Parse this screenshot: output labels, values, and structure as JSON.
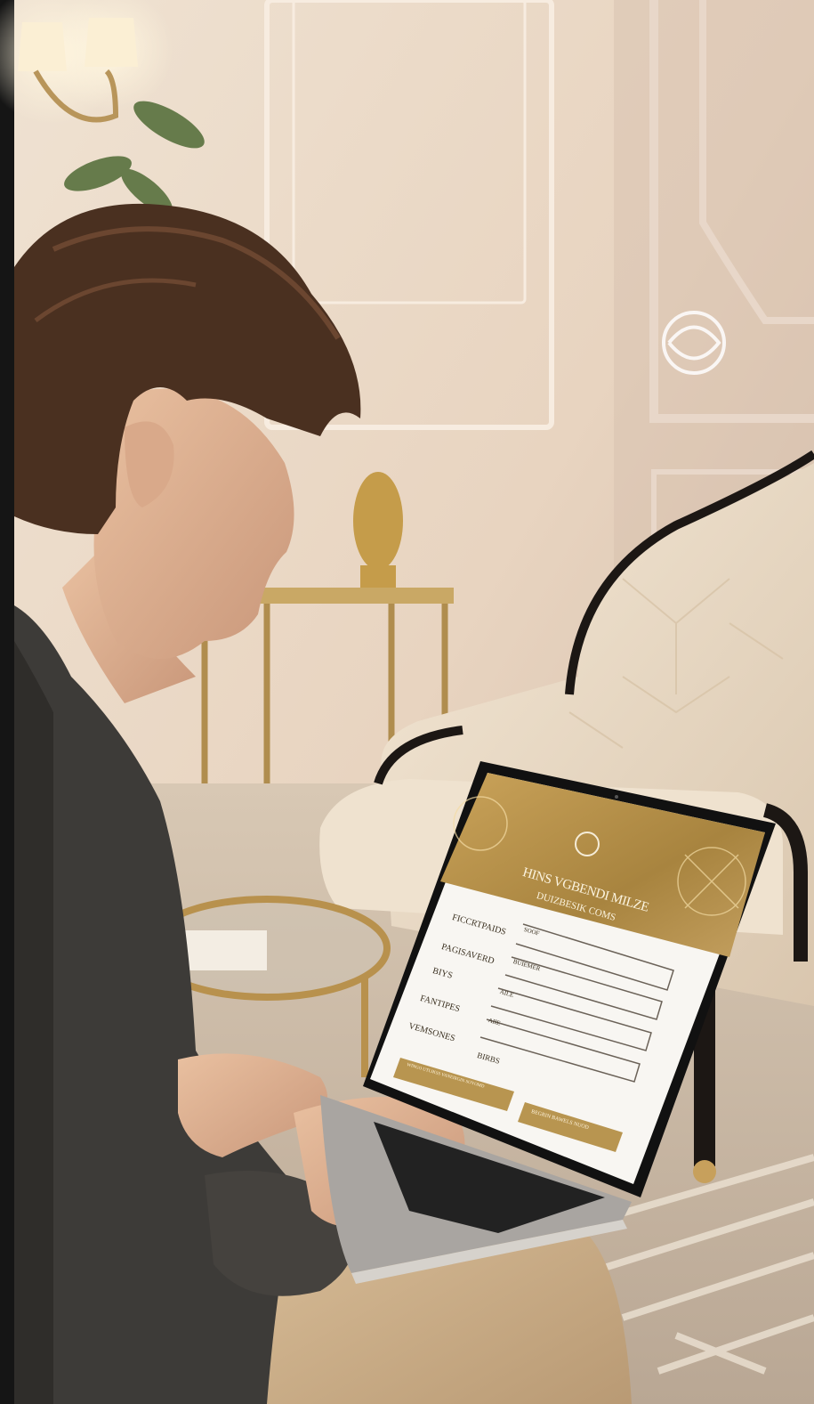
{
  "screen": {
    "header_title": "HINS VGBENDI MILZE",
    "header_subtitle": "DUIZBESIK COMS",
    "form_labels": [
      "FICCRTPAIDS",
      "PAGISAVERD",
      "BIYS",
      "FANTIPES",
      "VEMSONES"
    ],
    "field_hints": [
      "SOOF",
      "BUIEMER",
      "AILE",
      "AIIE"
    ],
    "extra_label": "BIRBS",
    "button_primary": "WINGO UTLIKSS VANEIRGIN SOYOMD",
    "button_secondary": "BEGRIN BAWELS NUOD"
  },
  "colors": {
    "gold": "#b89550",
    "gold_dark": "#8c6a30",
    "wall": "#e8d6c4",
    "jacket": "#3d3b38",
    "hair": "#4a3020"
  }
}
